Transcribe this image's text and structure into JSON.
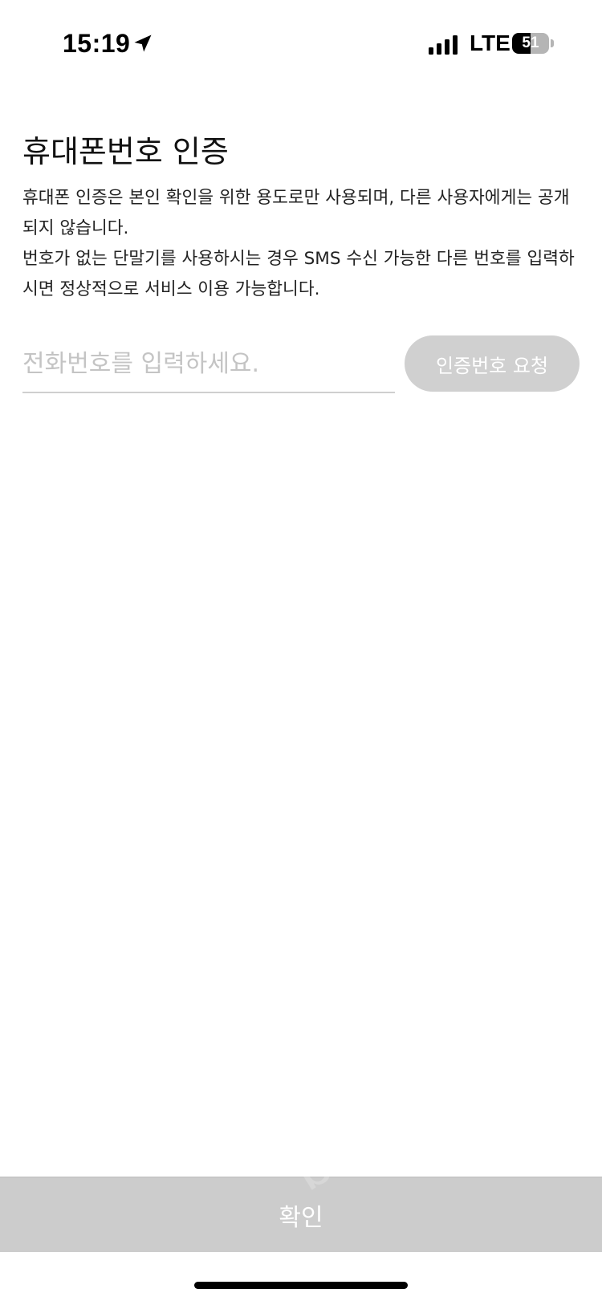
{
  "status_bar": {
    "time": "15:19",
    "location_icon": "location-arrow-icon",
    "signal_icon": "cellular-signal-icon",
    "network": "LTE",
    "battery_level": "51",
    "battery_percent": 51
  },
  "page": {
    "title": "휴대폰번호 인증",
    "description_lines": [
      "휴대폰 인증은 본인 확인을 위한 용도로만 사용되며, 다른 사용자에게는 공개되지 않습니다.",
      "번호가 없는 단말기를 사용하시는 경우 SMS 수신 가능한 다른 번호를 입력하시면 정상적으로 서비스 이용 가능합니다."
    ]
  },
  "phone_form": {
    "value": "",
    "placeholder": "전화번호를 입력하세요.",
    "request_button_label": "인증번호 요청"
  },
  "footer": {
    "confirm_label": "확인",
    "watermark": "bunjang"
  },
  "colors": {
    "disabled_button": "#d0d0d0",
    "confirm_bar": "#cccccc",
    "placeholder": "#c4c4c4",
    "underline": "#cfcfcf"
  }
}
